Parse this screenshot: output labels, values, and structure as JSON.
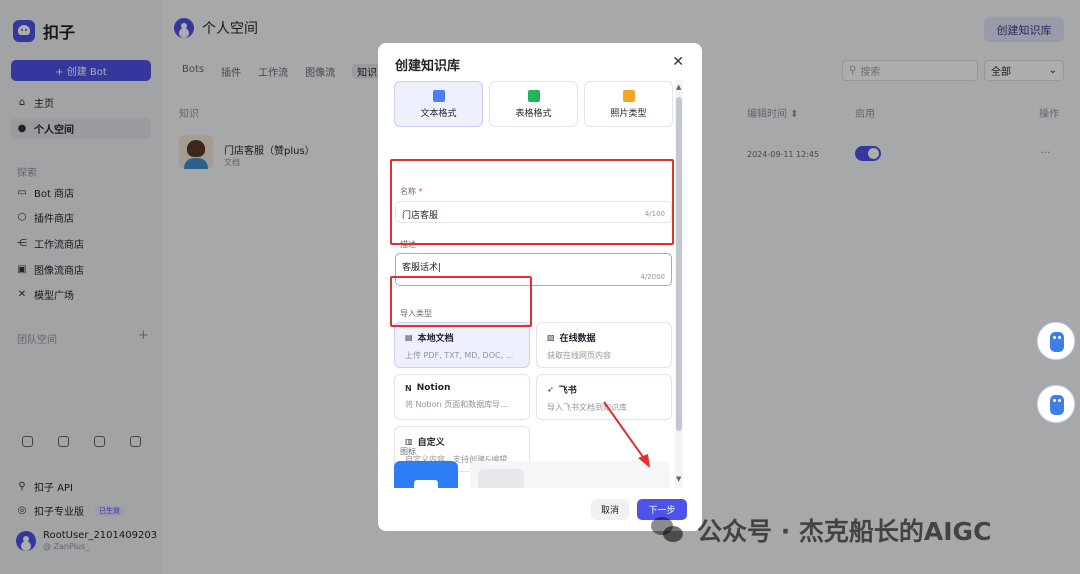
{
  "app": {
    "name": "扣子",
    "create_bot": "+ 创建 Bot"
  },
  "sidebar": {
    "primary": [
      {
        "label": "主页",
        "icon": "home-icon"
      },
      {
        "label": "个人空间",
        "icon": "person-icon",
        "active": true
      }
    ],
    "explore_label": "探索",
    "explore": [
      {
        "label": "Bot 商店",
        "icon": "bot-store-icon"
      },
      {
        "label": "插件商店",
        "icon": "plugin-icon"
      },
      {
        "label": "工作流商店",
        "icon": "workflow-icon"
      },
      {
        "label": "图像流商店",
        "icon": "image-icon"
      },
      {
        "label": "模型广场",
        "icon": "model-icon"
      }
    ],
    "team_label": "团队空间",
    "team_add": "+",
    "footer": [
      {
        "label": "扣子 API",
        "icon": "api-icon"
      },
      {
        "label": "扣子专业版",
        "icon": "pro-icon",
        "badge": "已生效"
      }
    ],
    "user": {
      "name": "RootUser_2101409203",
      "handle": "@ ZanPlus_"
    }
  },
  "main": {
    "title": "个人空间",
    "create_kb": "创建知识库",
    "tabs": [
      "Bots",
      "插件",
      "工作流",
      "图像流",
      "知识"
    ],
    "active_tab": "知识",
    "search_placeholder": "搜索",
    "filter_value": "全部",
    "columns": {
      "name": "知识",
      "edited": "编辑时间 ⬍",
      "enabled": "启用",
      "actions": "操作"
    },
    "rows": [
      {
        "title": "门店客服（赞plus）",
        "type": "文档",
        "edited": "2024-09-11 12:45",
        "enabled": true,
        "more": "···"
      }
    ]
  },
  "modal": {
    "title": "创建知识库",
    "close": "✕",
    "formats": [
      {
        "label": "文本格式",
        "color": "#4d7cf6",
        "selected": true
      },
      {
        "label": "表格格式",
        "color": "#22b35e",
        "selected": false
      },
      {
        "label": "照片类型",
        "color": "#f5a623",
        "selected": false
      }
    ],
    "name_label": "名称",
    "name_required": "*",
    "name_value": "门店客服",
    "name_counter": "4/100",
    "desc_label": "描述",
    "desc_value": "客服话术",
    "desc_counter": "4/2000",
    "import_label": "导入类型",
    "import_types": [
      {
        "title": "本地文档",
        "desc": "上传 PDF, TXT, MD, DOC, ...",
        "icon": "document-icon",
        "selected": true
      },
      {
        "title": "在线数据",
        "desc": "获取在线网页内容",
        "icon": "web-data-icon",
        "selected": false
      },
      {
        "title": "Notion",
        "desc": "将 Notion 页面和数据库导...",
        "icon": "notion-icon",
        "selected": false
      },
      {
        "title": "飞书",
        "desc": "导入飞书文档到知识库",
        "icon": "feishu-icon",
        "selected": false
      },
      {
        "title": "自定义",
        "desc": "自定义内容，支持创建&编辑",
        "icon": "custom-icon",
        "selected": false
      }
    ],
    "icon_label": "图标",
    "cancel": "取消",
    "next": "下一步"
  },
  "watermark": "公众号 · 杰克船长的AIGC",
  "colors": {
    "accent": "#4d53e8",
    "annotation": "#e03030"
  }
}
